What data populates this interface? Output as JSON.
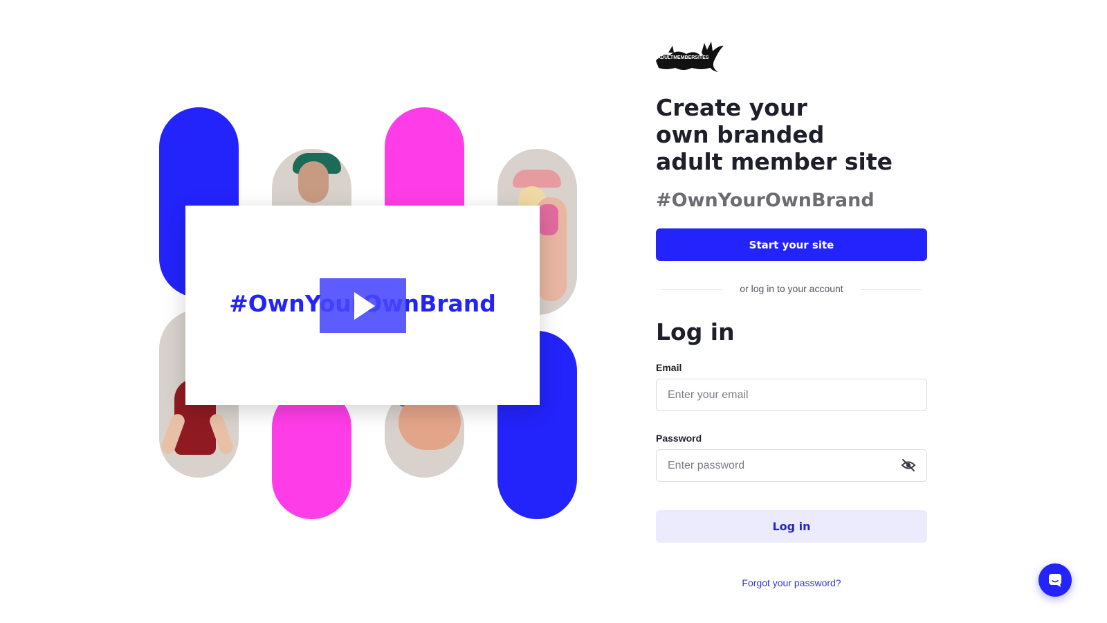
{
  "brand": {
    "logo_text": "ADULTMEMBERSITES",
    "primary_color": "#2323fb",
    "accent_color": "#ff3de8"
  },
  "hero": {
    "video_hashtag": "#OwnYourOwnBrand",
    "play_icon": "play-icon"
  },
  "signup": {
    "headline_lines": [
      "Create your",
      "own branded",
      "adult member site"
    ],
    "hashtag": "#OwnYourOwnBrand",
    "start_button_label": "Start your site",
    "divider_text": "or log in to your account"
  },
  "login": {
    "title": "Log in",
    "email_label": "Email",
    "email_placeholder": "Enter your email",
    "email_value": "",
    "password_label": "Password",
    "password_placeholder": "Enter password",
    "password_value": "",
    "password_toggle_icon": "eye-off-icon",
    "submit_label": "Log in",
    "forgot_password_text": "Forgot your password?"
  },
  "chat": {
    "icon": "chat-icon"
  }
}
